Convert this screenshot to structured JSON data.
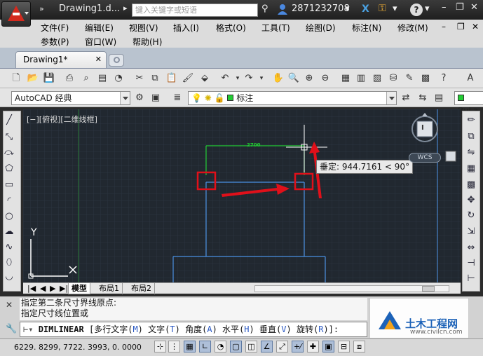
{
  "titlebar": {
    "doc_title": "Drawing1.d...",
    "search_placeholder": "键入关键字或短语",
    "user_id": "2871232708",
    "help_glyph": "?"
  },
  "menu": {
    "row1": [
      "文件(F)",
      "编辑(E)",
      "视图(V)",
      "插入(I)",
      "格式(O)",
      "工具(T)",
      "绘图(D)",
      "标注(N)",
      "修改(M)"
    ],
    "row2": [
      "参数(P)",
      "窗口(W)",
      "帮助(H)"
    ]
  },
  "tabs": {
    "document": "Drawing1*"
  },
  "toolbar": {
    "workspace": "AutoCAD 经典",
    "layer": "标注",
    "color": "ByLa"
  },
  "canvas": {
    "viewport_label": "[−][俯视][二维线框]",
    "dimension_text": "2700",
    "tooltip": "垂定: 944.7161 < 90°",
    "wcs_label": "WCS",
    "viewcube_label": "Ⅰ",
    "ucs_y": "Y"
  },
  "layout_tabs": [
    "模型",
    "布局1",
    "布局2"
  ],
  "command": {
    "history": [
      "指定第二条尺寸界线原点:",
      "指定尺寸线位置或"
    ],
    "name": "DIMLINEAR",
    "options": [
      {
        "label": "多行文字",
        "key": "M"
      },
      {
        "label": "文字",
        "key": "T"
      },
      {
        "label": "角度",
        "key": "A"
      },
      {
        "label": "水平",
        "key": "H"
      },
      {
        "label": "垂直",
        "key": "V"
      },
      {
        "label": "旋转",
        "key": "R"
      }
    ]
  },
  "watermark": {
    "title": "土木工程网",
    "url": "www.civilcn.com"
  },
  "status": {
    "coordinates": "6229. 8299,    7722. 3993, 0. 0000"
  },
  "colors": {
    "annotation_red": "#e0101a",
    "dim_green": "#22cc33",
    "geometry_blue": "#4a90e2"
  }
}
